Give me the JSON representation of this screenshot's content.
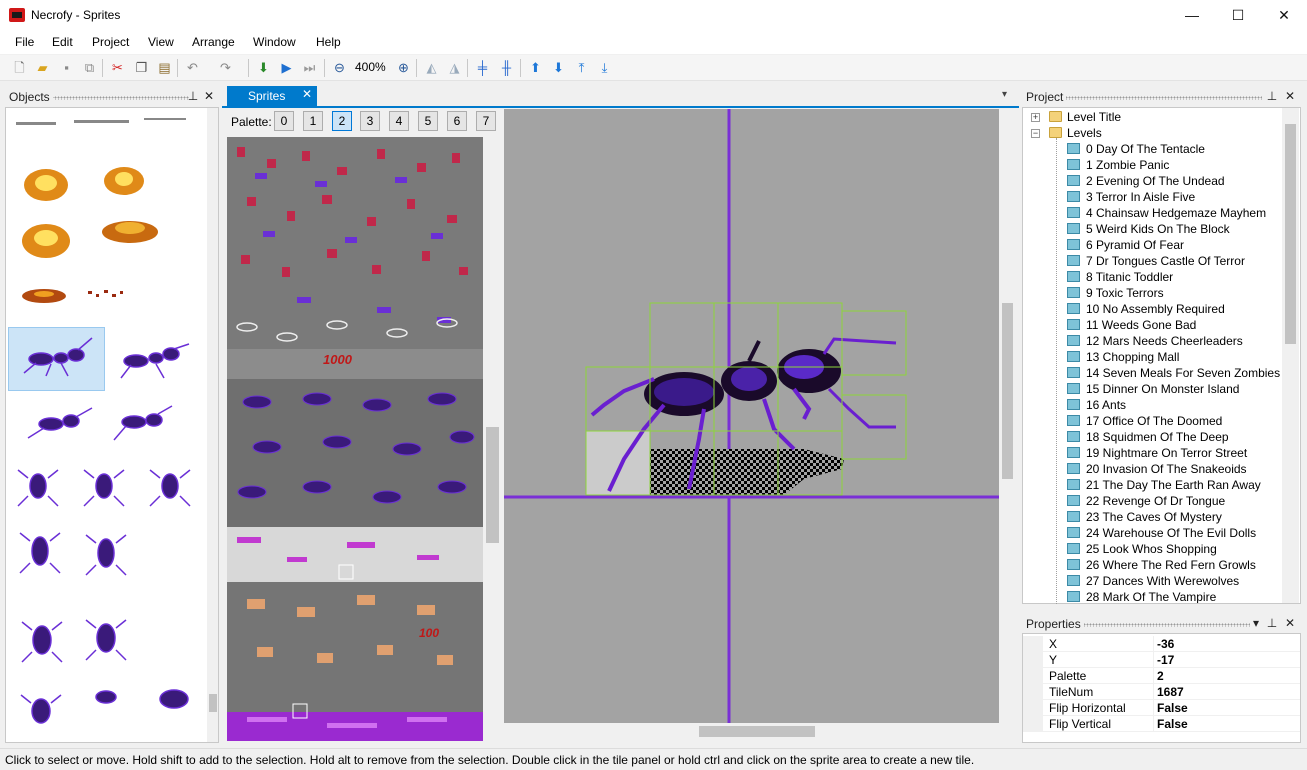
{
  "window": {
    "title": "Necrofy - Sprites",
    "minimize": "—",
    "maximize": "☐",
    "close": "✕"
  },
  "menu": [
    "File",
    "Edit",
    "Project",
    "View",
    "Arrange",
    "Window",
    "Help"
  ],
  "toolbar": {
    "zoom": "400%",
    "icons": [
      "new-file-icon",
      "open-folder-icon",
      "save-icon",
      "save-all-icon",
      "cut-icon",
      "copy-icon",
      "paste-icon",
      "undo-icon",
      "redo-icon",
      "build-icon",
      "run-icon",
      "run-from-level-icon",
      "zoom-out-icon",
      "zoom-in-icon",
      "flip-horizontal-icon",
      "flip-vertical-icon",
      "center-horizontal-icon",
      "center-vertical-icon",
      "move-up-icon",
      "move-down-icon",
      "move-to-top-icon",
      "move-to-bottom-icon"
    ]
  },
  "objects_panel": {
    "title": "Objects",
    "pin": "⊥",
    "close": "✕"
  },
  "document": {
    "tab_label": "Sprites",
    "tab_close": "✕",
    "dropdown": "▾"
  },
  "palette": {
    "label": "Palette:",
    "options": [
      "0",
      "1",
      "2",
      "3",
      "4",
      "5",
      "6",
      "7"
    ],
    "selected": "2"
  },
  "project_panel": {
    "title": "Project",
    "pin": "⊥",
    "close": "✕",
    "root_items": [
      "Level Title",
      "Levels"
    ],
    "levels": [
      "0 Day Of The Tentacle",
      "1 Zombie Panic",
      "2 Evening Of The Undead",
      "3 Terror In Aisle Five",
      "4 Chainsaw Hedgemaze Mayhem",
      "5 Weird Kids On The Block",
      "6 Pyramid Of Fear",
      "7 Dr Tongues Castle Of Terror",
      "8 Titanic Toddler",
      "9 Toxic Terrors",
      "10 No Assembly Required",
      "11 Weeds Gone Bad",
      "12 Mars Needs Cheerleaders",
      "13 Chopping Mall",
      "14 Seven Meals For Seven Zombies",
      "15 Dinner On Monster Island",
      "16 Ants",
      "17 Office Of The Doomed",
      "18 Squidmen Of The Deep",
      "19 Nightmare On Terror Street",
      "20 Invasion Of The Snakeoids",
      "21 The Day The Earth Ran Away",
      "22 Revenge Of Dr Tongue",
      "23 The Caves Of Mystery",
      "24 Warehouse Of The Evil Dolls",
      "25 Look Whos Shopping",
      "26 Where The Red Fern Growls",
      "27 Dances With Werewolves",
      "28 Mark Of The Vampire"
    ]
  },
  "properties_panel": {
    "title": "Properties",
    "dropdown": "▾",
    "pin": "⊥",
    "close": "✕",
    "rows": [
      {
        "name": "X",
        "value": "-36"
      },
      {
        "name": "Y",
        "value": "-17"
      },
      {
        "name": "Palette",
        "value": "2"
      },
      {
        "name": "TileNum",
        "value": "1687"
      },
      {
        "name": "Flip Horizontal",
        "value": "False"
      },
      {
        "name": "Flip Vertical",
        "value": "False"
      }
    ]
  },
  "status": "Click to select or move. Hold shift to add to the selection. Hold alt to remove from the selection. Double click in the tile panel or hold ctrl and click on the sprite area to create a new tile.",
  "colors": {
    "accent": "#007acc",
    "crosshair": "#7a2fd6",
    "tile_outline": "#8cd63a",
    "sprite_purple": "#6a1fd0",
    "canvas_bg": "#a3a3a3"
  }
}
